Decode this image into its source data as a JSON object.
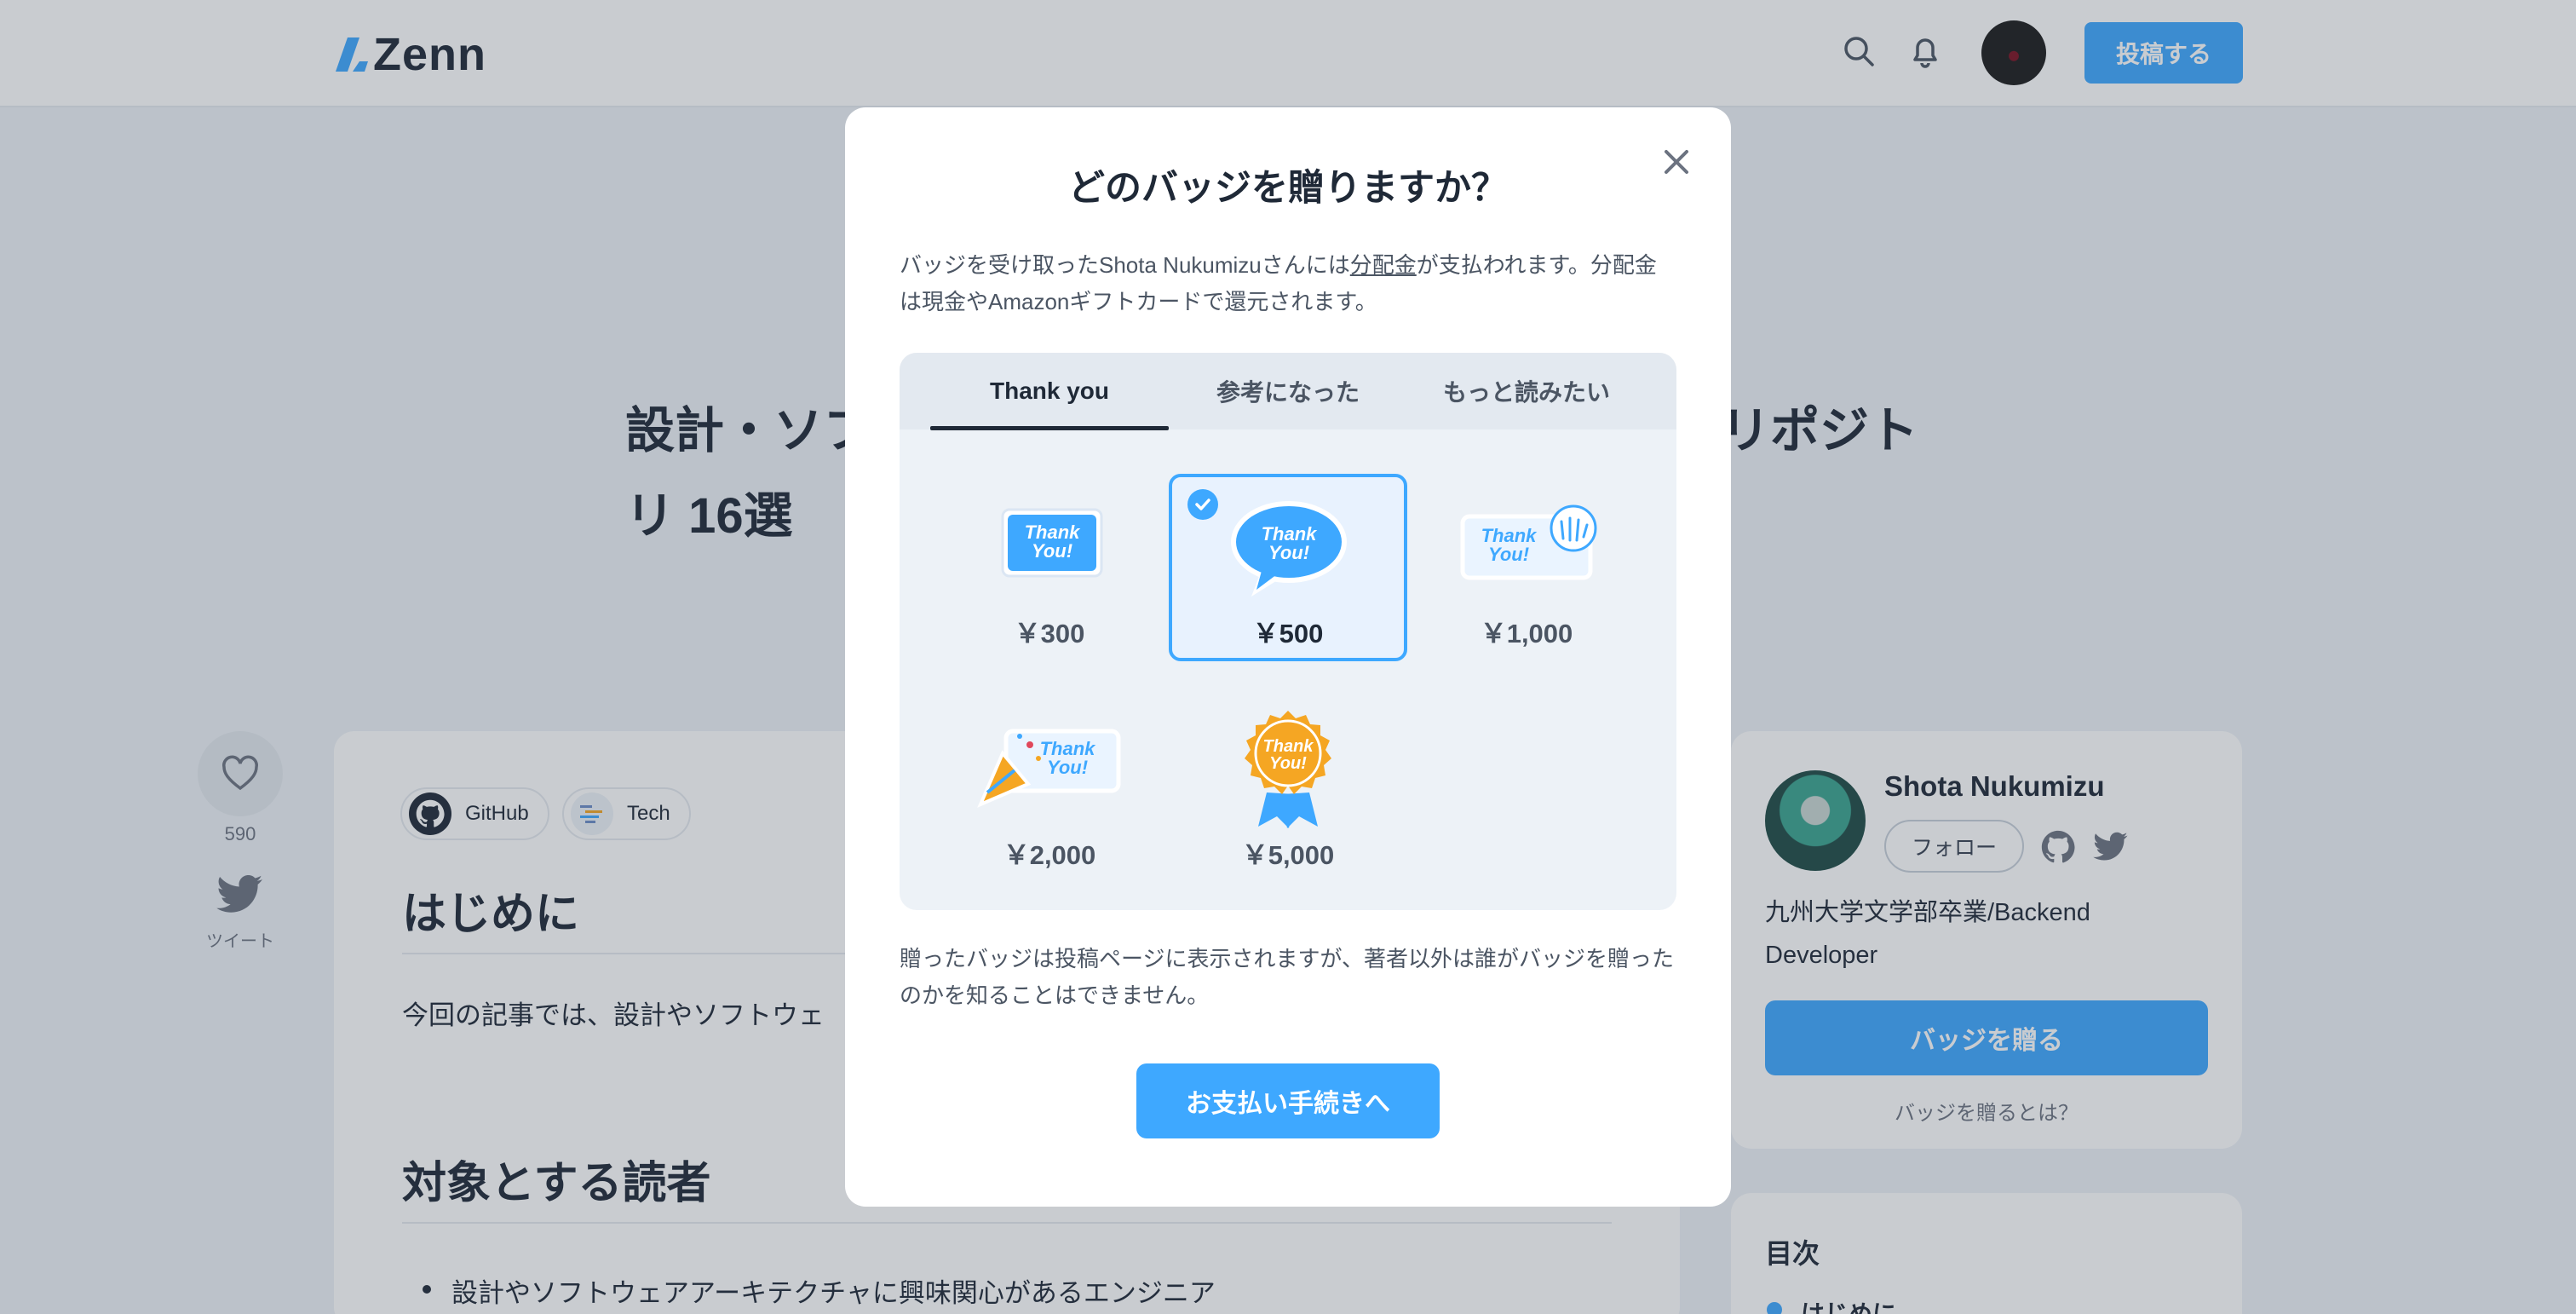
{
  "colors": {
    "accent": "#3ea8ff",
    "text": "#1f2937",
    "muted": "#4b5563",
    "panel": "#edf2f7",
    "badge_gold": "#f5a623"
  },
  "header": {
    "logo_text": "Zenn",
    "search_icon": "search-icon",
    "notification_icon": "bell-icon",
    "post_label": "投稿する"
  },
  "article": {
    "title_line1_left": "設計・ソフ",
    "title_line1_right": "リポジト",
    "title_line2": "リ 16選",
    "like_count": "590",
    "tweet_label": "ツイート",
    "topics": [
      {
        "label": "GitHub",
        "icon": "github-icon"
      },
      {
        "label": "Tech",
        "icon": "tech-icon"
      }
    ],
    "h2_intro": "はじめに",
    "intro_text": "今回の記事では、設計やソフトウェ",
    "h2_readers": "対象とする読者",
    "bullet1": "設計やソフトウェアアーキテクチャに興味関心があるエンジニア"
  },
  "author": {
    "name": "Shota Nukumizu",
    "follow_label": "フォロー",
    "bio": "九州大学文学部卒業/Backend Developer",
    "badge_button": "バッジを贈る",
    "badge_about": "バッジを贈るとは？"
  },
  "toc": {
    "title": "目次",
    "first_item": "はじめに"
  },
  "modal": {
    "title": "どのバッジを贈りますか？",
    "desc_before": "バッジを受け取ったShota Nukumizuさんには",
    "desc_link": "分配金",
    "desc_after": "が支払われます。分配金は現金やAmazonギフトカードで還元されます。",
    "tabs": [
      {
        "label": "Thank you",
        "active": true
      },
      {
        "label": "参考になった",
        "active": false
      },
      {
        "label": "もっと読みたい",
        "active": false
      }
    ],
    "badges": [
      {
        "label": "Thank You!",
        "price": "￥300",
        "selected": false
      },
      {
        "label": "Thank You!",
        "price": "￥500",
        "selected": true
      },
      {
        "label": "Thank You!",
        "price": "￥1,000",
        "selected": false
      },
      {
        "label": "Thank You!",
        "price": "￥2,000",
        "selected": false
      },
      {
        "label": "Thank You!",
        "price": "￥5,000",
        "selected": false
      }
    ],
    "note": "贈ったバッジは投稿ページに表示されますが、著者以外は誰がバッジを贈ったのかを知ることはできません。",
    "pay_button": "お支払い手続きへ"
  }
}
